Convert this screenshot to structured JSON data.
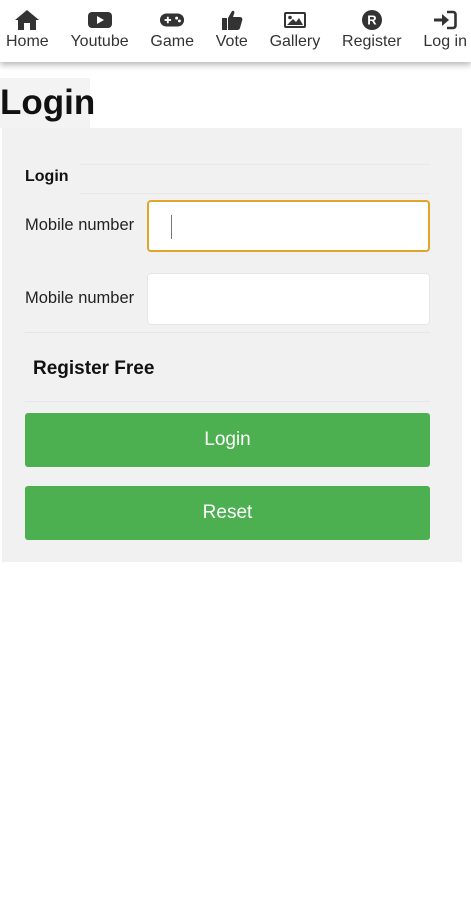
{
  "nav": {
    "items": [
      {
        "label": "Home",
        "icon": "home-icon"
      },
      {
        "label": "Youtube",
        "icon": "youtube-icon"
      },
      {
        "label": "Game",
        "icon": "gamepad-icon"
      },
      {
        "label": "Vote",
        "icon": "thumbs-up-icon"
      },
      {
        "label": "Gallery",
        "icon": "image-icon"
      },
      {
        "label": "Register",
        "icon": "registered-icon"
      },
      {
        "label": "Log in",
        "icon": "sign-in-icon"
      }
    ],
    "icon_color": "#333333"
  },
  "page": {
    "title": "Login"
  },
  "form": {
    "legend": "Login",
    "fields": [
      {
        "label": "Mobile number",
        "value": "",
        "focused": true
      },
      {
        "label": "Mobile number",
        "value": "",
        "focused": false
      }
    ],
    "register_link": "Register Free",
    "login_button": "Login",
    "reset_button": "Reset"
  },
  "colors": {
    "button": "#4caf50",
    "focus_border": "#e0a52b",
    "panel_bg": "#f1f1f1"
  }
}
